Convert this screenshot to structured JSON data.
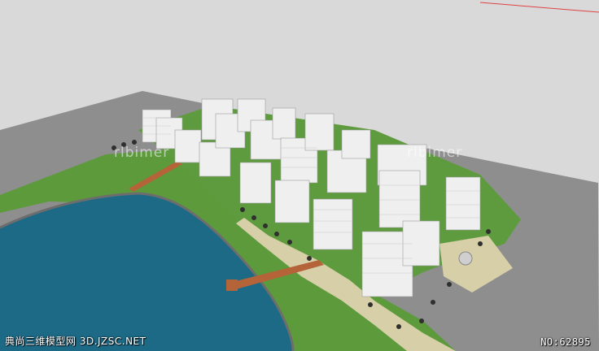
{
  "scene": {
    "description_colors": {
      "sky": "#d9d9d9",
      "ground": "#8e8e8e",
      "water": "#1d6a86",
      "grass": "#5c9a3c",
      "walkway": "#d6cfa8",
      "building": "#efefef",
      "pier": "#b5643a"
    }
  },
  "watermark": {
    "brand_left": "rlbimer",
    "brand_right": "rlbimer"
  },
  "caption": {
    "site_text": "典尚三维模型网 3D.JZSC.NET",
    "model_number": "NO:62895"
  }
}
